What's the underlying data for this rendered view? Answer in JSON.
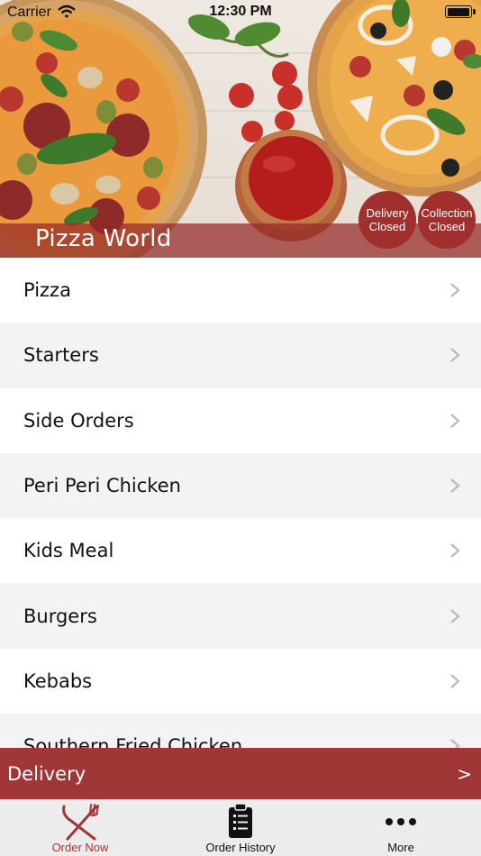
{
  "status_bar": {
    "carrier": "Carrier",
    "time": "12:30 PM"
  },
  "header": {
    "restaurant_name": "Pizza World",
    "badges": [
      {
        "line1": "Delivery",
        "line2": "Closed"
      },
      {
        "line1": "Collection",
        "line2": "Closed"
      }
    ]
  },
  "menu": {
    "categories": [
      {
        "label": "Pizza"
      },
      {
        "label": "Starters"
      },
      {
        "label": "Side Orders"
      },
      {
        "label": "Peri Peri Chicken"
      },
      {
        "label": "Kids Meal"
      },
      {
        "label": "Burgers"
      },
      {
        "label": "Kebabs"
      },
      {
        "label": "Southern Fried Chicken"
      }
    ]
  },
  "delivery_bar": {
    "label": "Delivery",
    "arrow": ">"
  },
  "tab_bar": {
    "tabs": [
      {
        "label": "Order Now",
        "icon": "fork-knife-icon",
        "active": true
      },
      {
        "label": "Order History",
        "icon": "clipboard-list-icon",
        "active": false
      },
      {
        "label": "More",
        "icon": "more-dots-icon",
        "active": false
      }
    ]
  },
  "colors": {
    "accent": "#a13636",
    "badge": "#a0302e",
    "list_alt_row": "#f2f3f5",
    "tab_bar": "#ececec"
  }
}
